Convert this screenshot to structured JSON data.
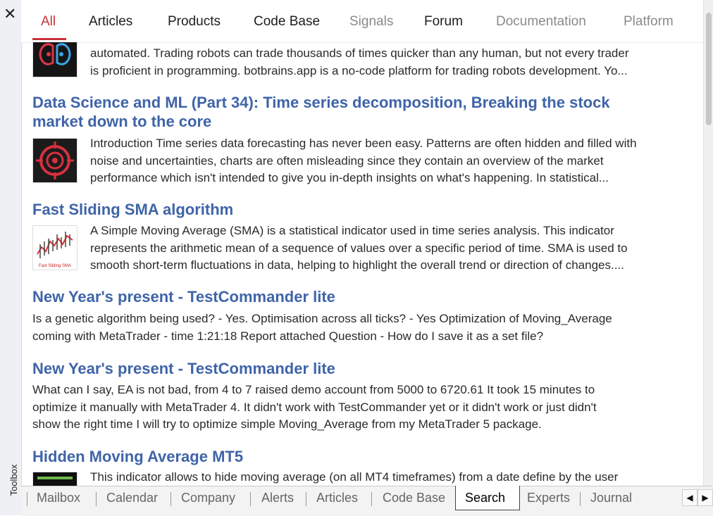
{
  "toolbox": {
    "close_glyph": "✕",
    "label": "Toolbox"
  },
  "top_tabs": [
    {
      "label": "All",
      "state": "active"
    },
    {
      "label": "Articles",
      "state": "normal"
    },
    {
      "label": "Products",
      "state": "normal"
    },
    {
      "label": "Code Base",
      "state": "normal"
    },
    {
      "label": "Signals",
      "state": "dim"
    },
    {
      "label": "Forum",
      "state": "normal"
    },
    {
      "label": "Documentation",
      "state": "dim"
    },
    {
      "label": "Platform",
      "state": "dim"
    }
  ],
  "results": [
    {
      "title": "",
      "icon": "brain-robot-icon",
      "text": [
        "automated. Trading robots can trade thousands of times quicker than any human, but not every trader",
        "is proficient in programming. botbrains.app is a no-code platform for trading robots development. Yo..."
      ]
    },
    {
      "title": [
        "Data Science and ML (Part 34): Time series decomposition, Breaking the stock",
        "market down to the core"
      ],
      "icon": "target-icon",
      "text": [
        "Introduction Time series data forecasting has never been easy. Patterns are often hidden and filled with",
        "noise and uncertainties, charts are often misleading since they contain an overview of the market",
        "performance which isn't intended to give you in-depth insights on what's happening. In statistical..."
      ]
    },
    {
      "title": "Fast Sliding SMA algorithm",
      "icon": "candlestick-chart-icon",
      "thumb_caption": "Fast Sliding SMA",
      "text": [
        "A Simple Moving Average (SMA) is a statistical indicator used in time series analysis. This indicator",
        "represents the arithmetic mean of a sequence of values over a specific period of time. SMA is used to",
        "smooth short-term fluctuations in data, helping to highlight the overall trend or direction of changes...."
      ]
    },
    {
      "title": "New Year's present - TestCommander lite",
      "text": [
        "Is a genetic algorithm being used? - Yes. Optimisation across all ticks? - Yes Optimization of Moving_Average",
        "coming with MetaTrader - time 1:21:18 Report attached Question - How do I save it as a set file?"
      ]
    },
    {
      "title": "New Year's present - TestCommander lite",
      "text": [
        "What can I say, EA is not bad, from 4 to 7 raised demo account from 5000 to 6720.61 It took 15 minutes to",
        "optimize it manually with MetaTrader 4. It didn't work with TestCommander yet or it didn't work or just didn't",
        "show the right time I will try to optimize simple Moving_Average from my MetaTrader 5 package."
      ]
    },
    {
      "title": "Hidden Moving Average MT5",
      "icon": "indicator-thumbnail-icon",
      "text": [
        "This indicator allows to hide moving average (on all MT4 timeframes) from a date define by the user"
      ]
    }
  ],
  "bottom_tabs": [
    {
      "label": "Mailbox"
    },
    {
      "label": "Calendar"
    },
    {
      "label": "Company"
    },
    {
      "label": "Alerts"
    },
    {
      "label": "Articles"
    },
    {
      "label": "Code Base"
    },
    {
      "label": "Search",
      "active": true
    },
    {
      "label": "Experts"
    },
    {
      "label": "Journal"
    }
  ],
  "scroll_arrows": {
    "left": "◀",
    "right": "▶"
  },
  "colors": {
    "accent": "#c9343a",
    "link": "#3f64a8",
    "text": "#2a2a2a"
  }
}
